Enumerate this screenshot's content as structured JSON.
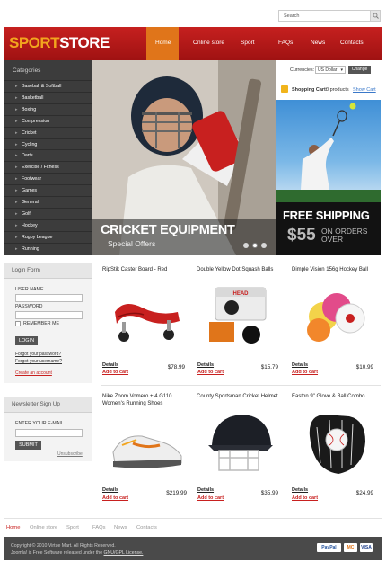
{
  "search": {
    "placeholder": "Search"
  },
  "logo": {
    "part1": "SPORT",
    "part2": "STORE"
  },
  "nav": [
    "Home",
    "Online store",
    "Sport",
    "FAQs",
    "News",
    "Contacts"
  ],
  "categories": {
    "title": "Categories",
    "items": [
      "Baseball & Softball",
      "Basketball",
      "Boxing",
      "Compression",
      "Cricket",
      "Cycling",
      "Darts",
      "Exercise / Fitness",
      "Footwear",
      "Games",
      "General",
      "Golf",
      "Hockey",
      "Rugby League",
      "Running"
    ]
  },
  "hero": {
    "title": "CRICKET EQUIPMENT",
    "subtitle": "Special Offers",
    "slides": 3,
    "active_slide": 1
  },
  "currency": {
    "label": "Currencies:",
    "selected": "US Dollar",
    "button": "Change"
  },
  "cart": {
    "label": "Shopping Cart:",
    "count": "0 products",
    "show": "Show Cart"
  },
  "shipping": {
    "title": "FREE SHIPPING",
    "price": "$55",
    "line1": "ON ORDERS",
    "line2": "OVER"
  },
  "login": {
    "title": "Login Form",
    "username_label": "USER NAME",
    "password_label": "PASSWORD",
    "remember_label": "REMEMBER ME",
    "button": "LOGIN",
    "forgot_password": "Forgot your password?",
    "forgot_username": "Forgot your username?",
    "create": "Create an account"
  },
  "newsletter": {
    "title": "Newsletter Sign Up",
    "email_label": "ENTER YOUR E-MAIL",
    "button": "SUBMIT",
    "unsubscribe": "Unsubscribe"
  },
  "products": [
    {
      "title": "RipStik Caster Board - Red",
      "details": "Details",
      "add": "Add to cart",
      "price": "$78.99"
    },
    {
      "title": "Double Yellow Dot Squash Balls",
      "details": "Details",
      "add": "Add to cart",
      "price": "$15.79"
    },
    {
      "title": "Dimple Vision 156g Hockey Ball",
      "details": "Details",
      "add": "Add to cart",
      "price": "$10.99"
    },
    {
      "title": "Nike Zoom Vomero + 4 G110 Women's Running Shoes",
      "details": "Details",
      "add": "Add to cart",
      "price": "$219.99"
    },
    {
      "title": "County Sportsman Cricket Helmet",
      "details": "Details",
      "add": "Add to cart",
      "price": "$35.99"
    },
    {
      "title": "Easton 9\" Glove & Ball Combo",
      "details": "Details",
      "add": "Add to cart",
      "price": "$24.99"
    }
  ],
  "footer": {
    "nav": [
      "Home",
      "Online store",
      "Sport",
      "FAQs",
      "News",
      "Contacts"
    ],
    "copyright": "Copyright © 2010 Virtue Mart. All Rights Reserved.",
    "joomla_prefix": "Joomla! is Free Software released under the ",
    "license": "GNU/GPL License.",
    "payments": [
      "PayPal",
      "MC",
      "VISA"
    ]
  },
  "colors": {
    "brand_red": "#c6201f",
    "accent_orange": "#e0751a",
    "logo_orange": "#f2a51e",
    "link_blue": "#3a78c9"
  }
}
